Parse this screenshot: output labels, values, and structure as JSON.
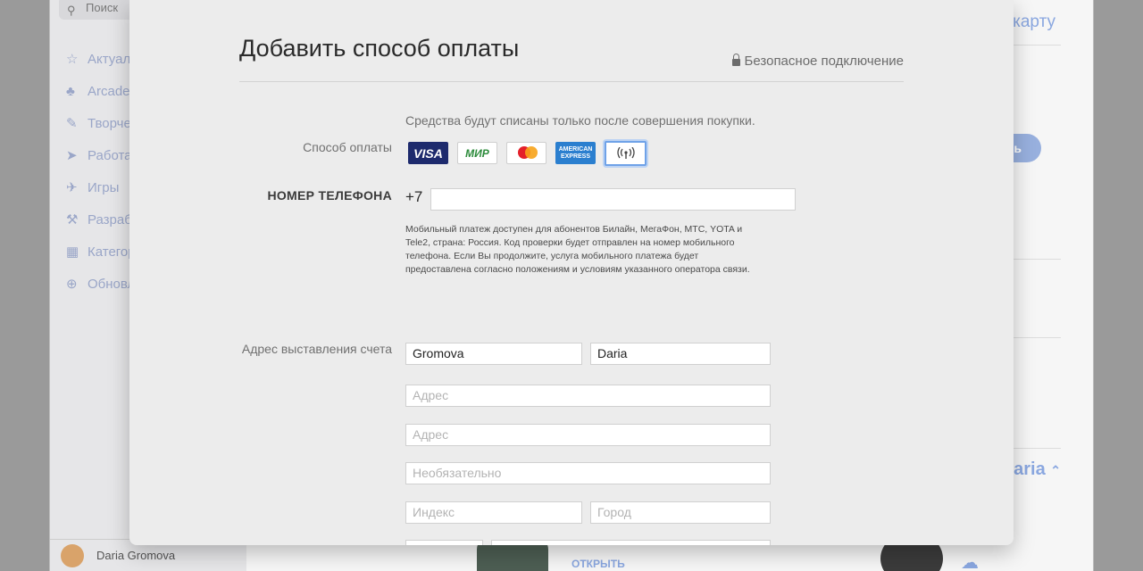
{
  "background": {
    "search_placeholder": "Поиск",
    "nav_items": [
      {
        "label": "Актуально",
        "icon": "star-icon"
      },
      {
        "label": "Arcade",
        "icon": "joystick-icon"
      },
      {
        "label": "Творчество",
        "icon": "brush-icon"
      },
      {
        "label": "Работа",
        "icon": "paperplane-icon"
      },
      {
        "label": "Игры",
        "icon": "rocket-icon"
      },
      {
        "label": "Разработка",
        "icon": "hammer-icon"
      },
      {
        "label": "Категории",
        "icon": "grid-icon"
      },
      {
        "label": "Обновления",
        "icon": "download-icon"
      }
    ],
    "user_name": "Daria Gromova",
    "add_card_link": "карту",
    "pill_label": "ть",
    "account_name": "aria",
    "open_label": "ОТКРЫТЬ"
  },
  "modal": {
    "title": "Добавить способ оплаты",
    "secure_label": "Безопасное подключение",
    "charge_note": "Средства будут списаны только после совершения покупки.",
    "payment_method_label": "Способ оплаты",
    "cards": [
      {
        "name": "visa",
        "label": "VISA"
      },
      {
        "name": "mir",
        "label": "МИР"
      },
      {
        "name": "mastercard",
        "label": "mastercard"
      },
      {
        "name": "amex",
        "label": "AMERICAN EXPRESS"
      },
      {
        "name": "mobile",
        "label": "((•))"
      }
    ],
    "phone_label": "НОМЕР ТЕЛЕФОНА",
    "phone_prefix": "+7",
    "phone_value": "",
    "help_text": "Мобильный платеж доступен для абонентов Билайн, МегаФон, МТС, YOTA и Tele2, страна: Россия. Код проверки будет отправлен на номер мобильного телефона. Если Вы продолжите, услуга мобильного платежа будет предоставлена согласно положениям и условиям указанного оператора связи.",
    "billing_label": "Адрес выставления счета",
    "last_name": "Gromova",
    "first_name": "Daria",
    "address1_placeholder": "Адрес",
    "address2_placeholder": "Адрес",
    "optional_placeholder": "Необязательно",
    "zip_placeholder": "Индекс",
    "city_placeholder": "Город"
  }
}
